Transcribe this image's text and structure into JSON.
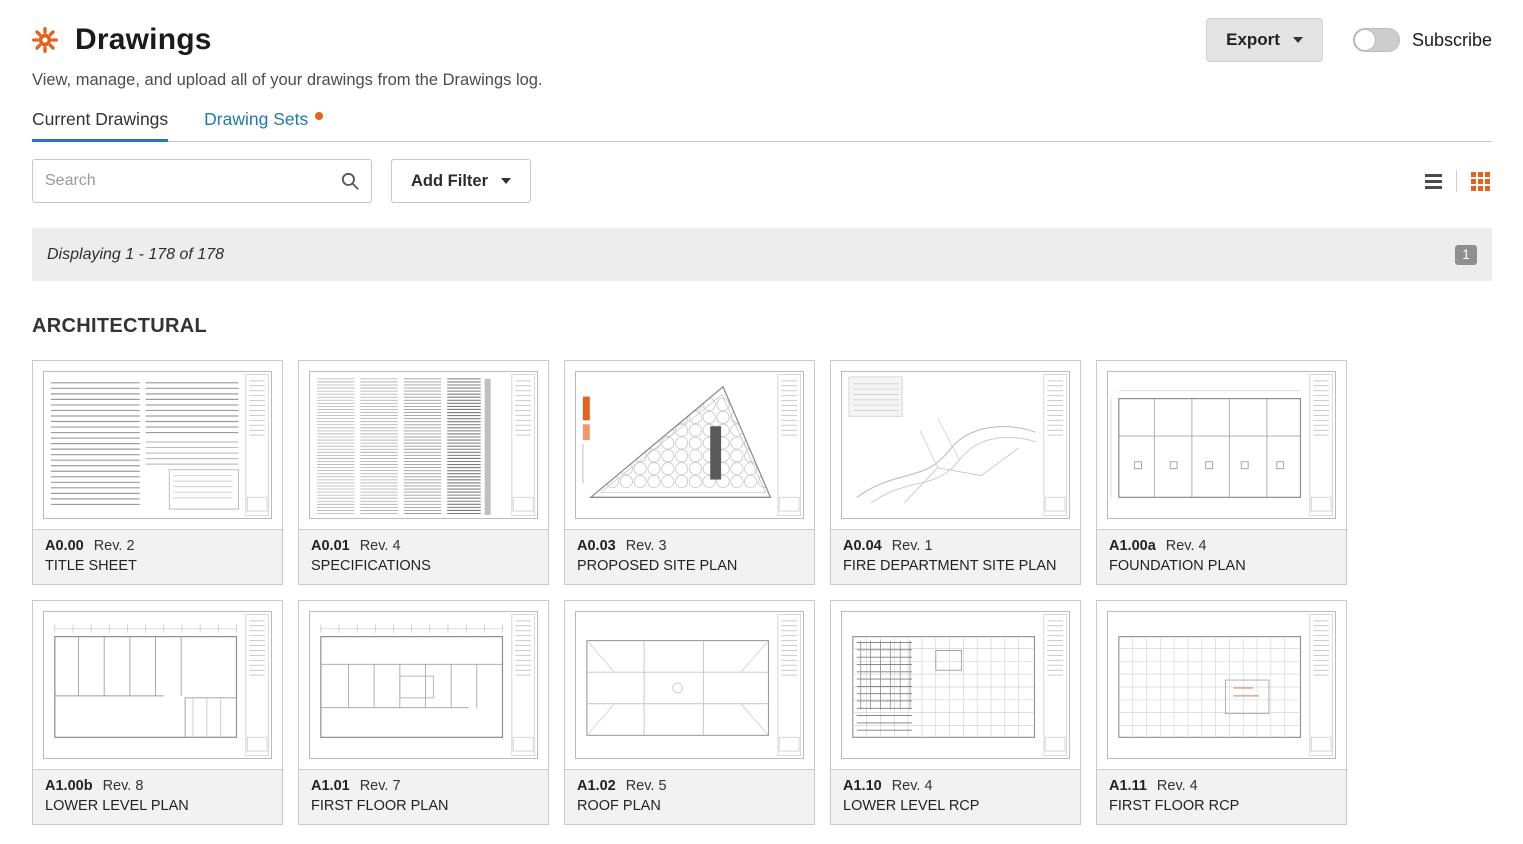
{
  "colors": {
    "accent_orange": "#e8611c",
    "link_blue": "#2379ad",
    "status_bar_bg": "#ededed",
    "card_footer_bg": "#f2f2f2"
  },
  "header": {
    "title": "Drawings",
    "subtitle": "View, manage, and upload all of your drawings from the Drawings log.",
    "export_label": "Export",
    "subscribe_label": "Subscribe"
  },
  "tabs": [
    {
      "label": "Current Drawings",
      "active": true
    },
    {
      "label": "Drawing Sets",
      "active": false,
      "has_badge_dot": true
    }
  ],
  "toolbar": {
    "search_placeholder": "Search",
    "add_filter_label": "Add Filter",
    "active_view": "grid"
  },
  "status": {
    "text": "Displaying 1 - 178 of 178",
    "page": "1"
  },
  "section": {
    "title": "ARCHITECTURAL"
  },
  "cards": [
    {
      "number": "A0.00",
      "rev": "Rev. 2",
      "title": "TITLE SHEET",
      "thumb": "title"
    },
    {
      "number": "A0.01",
      "rev": "Rev. 4",
      "title": "SPECIFICATIONS",
      "thumb": "spec"
    },
    {
      "number": "A0.03",
      "rev": "Rev. 3",
      "title": "PROPOSED SITE PLAN",
      "thumb": "siteplan"
    },
    {
      "number": "A0.04",
      "rev": "Rev. 1",
      "title": "FIRE DEPARTMENT SITE PLAN",
      "thumb": "firesite"
    },
    {
      "number": "A1.00a",
      "rev": "Rev. 4",
      "title": "FOUNDATION PLAN",
      "thumb": "foundation"
    },
    {
      "number": "A1.00b",
      "rev": "Rev. 8",
      "title": "LOWER LEVEL PLAN",
      "thumb": "lowerlevel"
    },
    {
      "number": "A1.01",
      "rev": "Rev. 7",
      "title": "FIRST FLOOR PLAN",
      "thumb": "firstfloor"
    },
    {
      "number": "A1.02",
      "rev": "Rev. 5",
      "title": "ROOF PLAN",
      "thumb": "roof"
    },
    {
      "number": "A1.10",
      "rev": "Rev. 4",
      "title": "LOWER LEVEL RCP",
      "thumb": "rcpdense"
    },
    {
      "number": "A1.11",
      "rev": "Rev. 4",
      "title": "FIRST FLOOR RCP",
      "thumb": "rcp"
    }
  ]
}
